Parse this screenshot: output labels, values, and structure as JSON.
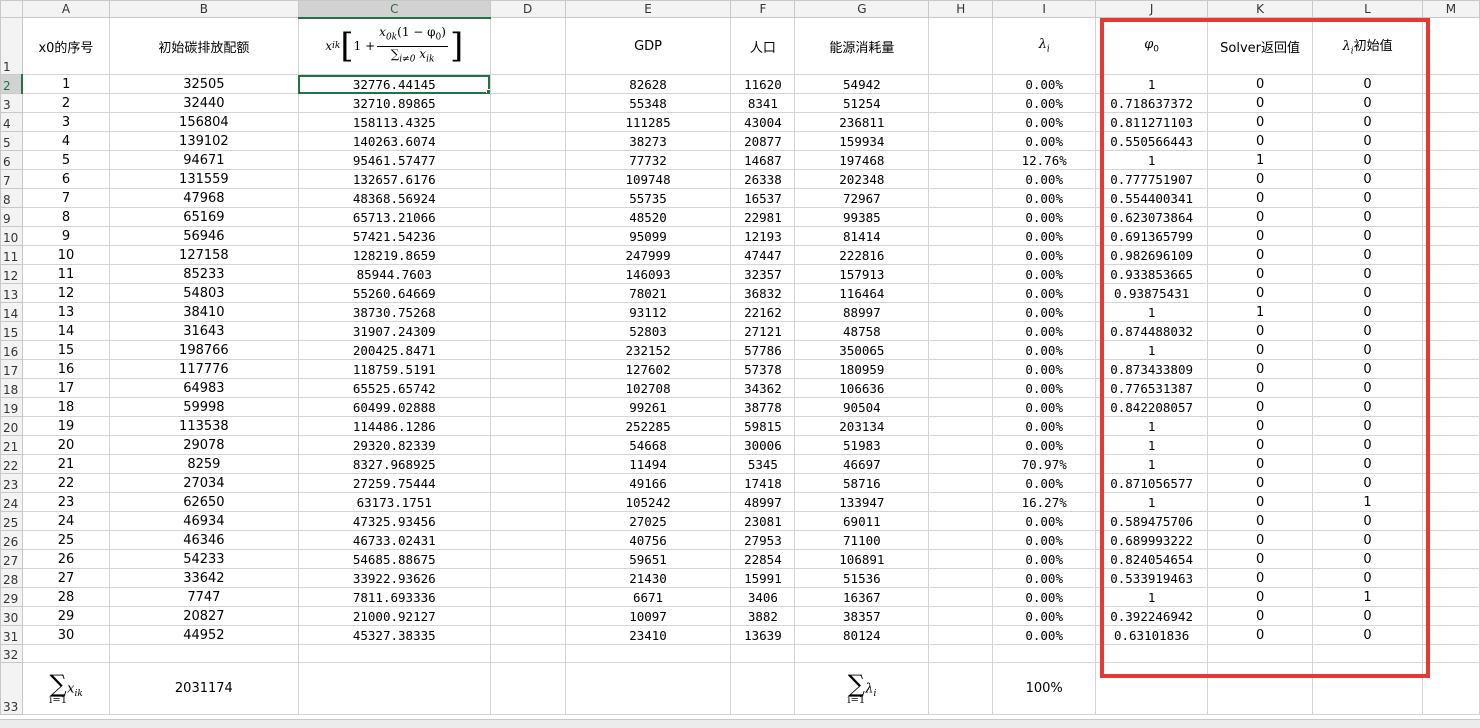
{
  "columns": [
    "A",
    "B",
    "C",
    "D",
    "E",
    "F",
    "G",
    "H",
    "I",
    "J",
    "K",
    "L",
    "M"
  ],
  "selected": {
    "column": "C",
    "row": "2"
  },
  "header_row": {
    "row_label": "1",
    "A": "x0的序号",
    "B": "初始碳排放配额",
    "C_formula_parts": {
      "lead": "x",
      "lead_sub": "ik",
      "one_plus": "1 +",
      "num": "x",
      "num_sub": "0k",
      "num_rest": "(1 − φ",
      "num_rest_sub": "0",
      "num_close": ")",
      "den_sum": "∑",
      "den_sub": "i≠0",
      "den_x": "x",
      "den_x_sub": "ik"
    },
    "E": "GDP",
    "F": "人口",
    "G": "能源消耗量",
    "I_symbol": "λ",
    "I_sub": "i",
    "J_symbol": "φ",
    "J_sub": "0",
    "K": "Solver返回值",
    "L_symbol": "λ",
    "L_sub": "i",
    "L_rest": "初始值"
  },
  "rows": [
    {
      "r": "2",
      "A": "1",
      "B": "32505",
      "C": "32776.44145",
      "E": "82628",
      "F": "11620",
      "G": "54942",
      "I": "0.00%",
      "J": "1",
      "K": "0",
      "L": "0"
    },
    {
      "r": "3",
      "A": "2",
      "B": "32440",
      "C": "32710.89865",
      "E": "55348",
      "F": "8341",
      "G": "51254",
      "I": "0.00%",
      "J": "0.718637372",
      "K": "0",
      "L": "0"
    },
    {
      "r": "4",
      "A": "3",
      "B": "156804",
      "C": "158113.4325",
      "E": "111285",
      "F": "43004",
      "G": "236811",
      "I": "0.00%",
      "J": "0.811271103",
      "K": "0",
      "L": "0"
    },
    {
      "r": "5",
      "A": "4",
      "B": "139102",
      "C": "140263.6074",
      "E": "38273",
      "F": "20877",
      "G": "159934",
      "I": "0.00%",
      "J": "0.550566443",
      "K": "0",
      "L": "0"
    },
    {
      "r": "6",
      "A": "5",
      "B": "94671",
      "C": "95461.57477",
      "E": "77732",
      "F": "14687",
      "G": "197468",
      "I": "12.76%",
      "J": "1",
      "K": "1",
      "L": "0"
    },
    {
      "r": "7",
      "A": "6",
      "B": "131559",
      "C": "132657.6176",
      "E": "109748",
      "F": "26338",
      "G": "202348",
      "I": "0.00%",
      "J": "0.777751907",
      "K": "0",
      "L": "0"
    },
    {
      "r": "8",
      "A": "7",
      "B": "47968",
      "C": "48368.56924",
      "E": "55735",
      "F": "16537",
      "G": "72967",
      "I": "0.00%",
      "J": "0.554400341",
      "K": "0",
      "L": "0"
    },
    {
      "r": "9",
      "A": "8",
      "B": "65169",
      "C": "65713.21066",
      "E": "48520",
      "F": "22981",
      "G": "99385",
      "I": "0.00%",
      "J": "0.623073864",
      "K": "0",
      "L": "0"
    },
    {
      "r": "10",
      "A": "9",
      "B": "56946",
      "C": "57421.54236",
      "E": "95099",
      "F": "12193",
      "G": "81414",
      "I": "0.00%",
      "J": "0.691365799",
      "K": "0",
      "L": "0"
    },
    {
      "r": "11",
      "A": "10",
      "B": "127158",
      "C": "128219.8659",
      "E": "247999",
      "F": "47447",
      "G": "222816",
      "I": "0.00%",
      "J": "0.982696109",
      "K": "0",
      "L": "0"
    },
    {
      "r": "12",
      "A": "11",
      "B": "85233",
      "C": "85944.7603",
      "E": "146093",
      "F": "32357",
      "G": "157913",
      "I": "0.00%",
      "J": "0.933853665",
      "K": "0",
      "L": "0"
    },
    {
      "r": "13",
      "A": "12",
      "B": "54803",
      "C": "55260.64669",
      "E": "78021",
      "F": "36832",
      "G": "116464",
      "I": "0.00%",
      "J": "0.93875431",
      "K": "0",
      "L": "0"
    },
    {
      "r": "14",
      "A": "13",
      "B": "38410",
      "C": "38730.75268",
      "E": "93112",
      "F": "22162",
      "G": "88997",
      "I": "0.00%",
      "J": "1",
      "K": "1",
      "L": "0"
    },
    {
      "r": "15",
      "A": "14",
      "B": "31643",
      "C": "31907.24309",
      "E": "52803",
      "F": "27121",
      "G": "48758",
      "I": "0.00%",
      "J": "0.874488032",
      "K": "0",
      "L": "0"
    },
    {
      "r": "16",
      "A": "15",
      "B": "198766",
      "C": "200425.8471",
      "E": "232152",
      "F": "57786",
      "G": "350065",
      "I": "0.00%",
      "J": "1",
      "K": "0",
      "L": "0"
    },
    {
      "r": "17",
      "A": "16",
      "B": "117776",
      "C": "118759.5191",
      "E": "127602",
      "F": "57378",
      "G": "180959",
      "I": "0.00%",
      "J": "0.873433809",
      "K": "0",
      "L": "0"
    },
    {
      "r": "18",
      "A": "17",
      "B": "64983",
      "C": "65525.65742",
      "E": "102708",
      "F": "34362",
      "G": "106636",
      "I": "0.00%",
      "J": "0.776531387",
      "K": "0",
      "L": "0"
    },
    {
      "r": "19",
      "A": "18",
      "B": "59998",
      "C": "60499.02888",
      "E": "99261",
      "F": "38778",
      "G": "90504",
      "I": "0.00%",
      "J": "0.842208057",
      "K": "0",
      "L": "0"
    },
    {
      "r": "20",
      "A": "19",
      "B": "113538",
      "C": "114486.1286",
      "E": "252285",
      "F": "59815",
      "G": "203134",
      "I": "0.00%",
      "J": "1",
      "K": "0",
      "L": "0"
    },
    {
      "r": "21",
      "A": "20",
      "B": "29078",
      "C": "29320.82339",
      "E": "54668",
      "F": "30006",
      "G": "51983",
      "I": "0.00%",
      "J": "1",
      "K": "0",
      "L": "0"
    },
    {
      "r": "22",
      "A": "21",
      "B": "8259",
      "C": "8327.968925",
      "E": "11494",
      "F": "5345",
      "G": "46697",
      "I": "70.97%",
      "J": "1",
      "K": "0",
      "L": "0"
    },
    {
      "r": "23",
      "A": "22",
      "B": "27034",
      "C": "27259.75444",
      "E": "49166",
      "F": "17418",
      "G": "58716",
      "I": "0.00%",
      "J": "0.871056577",
      "K": "0",
      "L": "0"
    },
    {
      "r": "24",
      "A": "23",
      "B": "62650",
      "C": "63173.1751",
      "E": "105242",
      "F": "48997",
      "G": "133947",
      "I": "16.27%",
      "J": "1",
      "K": "0",
      "L": "1"
    },
    {
      "r": "25",
      "A": "24",
      "B": "46934",
      "C": "47325.93456",
      "E": "27025",
      "F": "23081",
      "G": "69011",
      "I": "0.00%",
      "J": "0.589475706",
      "K": "0",
      "L": "0"
    },
    {
      "r": "26",
      "A": "25",
      "B": "46346",
      "C": "46733.02431",
      "E": "40756",
      "F": "27953",
      "G": "71100",
      "I": "0.00%",
      "J": "0.689993222",
      "K": "0",
      "L": "0"
    },
    {
      "r": "27",
      "A": "26",
      "B": "54233",
      "C": "54685.88675",
      "E": "59651",
      "F": "22854",
      "G": "106891",
      "I": "0.00%",
      "J": "0.824054654",
      "K": "0",
      "L": "0"
    },
    {
      "r": "28",
      "A": "27",
      "B": "33642",
      "C": "33922.93626",
      "E": "21430",
      "F": "15991",
      "G": "51536",
      "I": "0.00%",
      "J": "0.533919463",
      "K": "0",
      "L": "0"
    },
    {
      "r": "29",
      "A": "28",
      "B": "7747",
      "C": "7811.693336",
      "E": "6671",
      "F": "3406",
      "G": "16367",
      "I": "0.00%",
      "J": "1",
      "K": "0",
      "L": "1"
    },
    {
      "r": "30",
      "A": "29",
      "B": "20827",
      "C": "21000.92127",
      "E": "10097",
      "F": "3882",
      "G": "38357",
      "I": "0.00%",
      "J": "0.392246942",
      "K": "0",
      "L": "0"
    },
    {
      "r": "31",
      "A": "30",
      "B": "44952",
      "C": "45327.38335",
      "E": "23410",
      "F": "13639",
      "G": "80124",
      "I": "0.00%",
      "J": "0.63101836",
      "K": "0",
      "L": "0"
    }
  ],
  "row32_label": "32",
  "row33": {
    "label": "33",
    "A_sum": "∑",
    "A_lower": "i=1",
    "A_x": "x",
    "A_sub": "ik",
    "B": "2031174",
    "G_sum": "∑",
    "G_lower": "i=1",
    "G_sym": "λ",
    "G_sub": "i",
    "I": "100%"
  },
  "highlight_color": "#e53935",
  "accent_color": "#217346"
}
